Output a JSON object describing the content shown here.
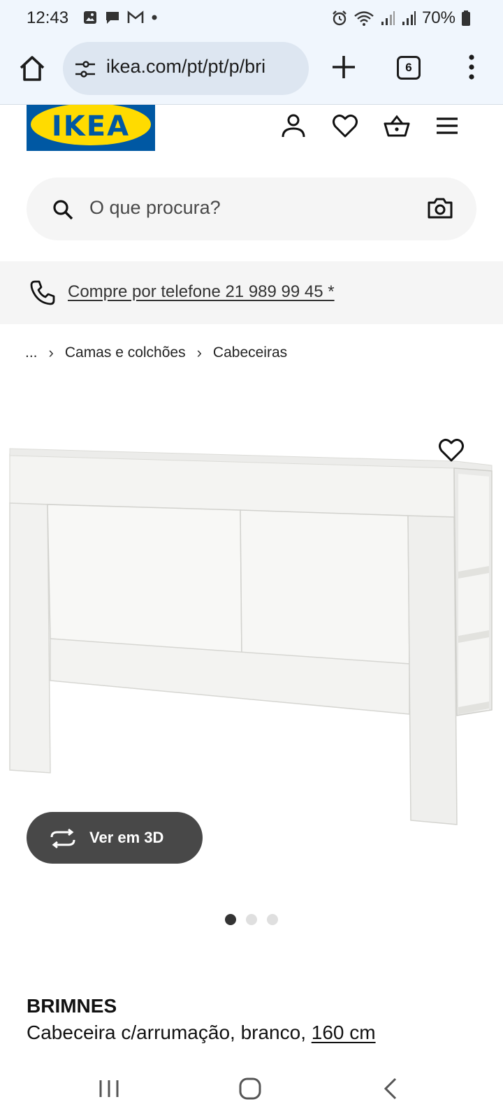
{
  "status_bar": {
    "time": "12:43",
    "battery": "70%"
  },
  "browser": {
    "url": "ikea.com/pt/pt/p/bri",
    "tab_count": "6"
  },
  "header": {
    "logo_text": "IKEA",
    "brand_blue": "#0058a3",
    "brand_yellow": "#ffdb00"
  },
  "search": {
    "placeholder": "O que procura?"
  },
  "phone_banner": {
    "text": "Compre por telefone 21 989 99 45 *"
  },
  "breadcrumb": {
    "ellipsis": "...",
    "items": [
      "Camas e colchões",
      "Cabeceiras"
    ]
  },
  "gallery": {
    "view_3d_label": "Ver em 3D",
    "slide_count": 3,
    "active_slide": 1
  },
  "product": {
    "name": "BRIMNES",
    "description": "Cabeceira c/arrumação, branco, ",
    "size": "160 cm"
  }
}
